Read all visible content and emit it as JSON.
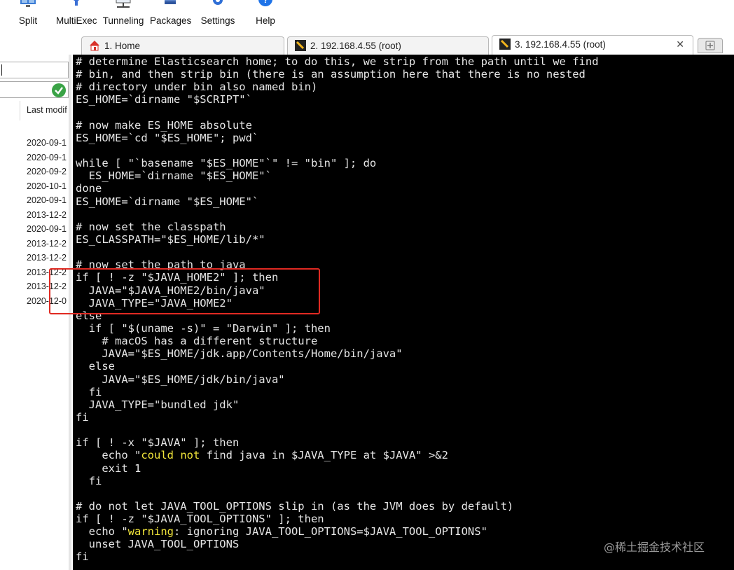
{
  "toolbar": {
    "buttons": [
      {
        "label": "Split",
        "icon": "split-icon"
      },
      {
        "label": "MultiExec",
        "icon": "multiexec-icon"
      },
      {
        "label": "Tunneling",
        "icon": "tunneling-icon"
      },
      {
        "label": "Packages",
        "icon": "packages-icon"
      },
      {
        "label": "Settings",
        "icon": "gear-icon"
      },
      {
        "label": "Help",
        "icon": "help-icon"
      }
    ]
  },
  "tabs": [
    {
      "label": "1. Home",
      "icon": "home-icon",
      "active": false
    },
    {
      "label": "2. 192.168.4.55 (root)",
      "icon": "ssh-icon",
      "active": false
    },
    {
      "label": "3. 192.168.4.55 (root)",
      "icon": "ssh-icon",
      "active": true,
      "close": "✕"
    }
  ],
  "file_browser": {
    "column_header": "Last modif",
    "dates": [
      "2020-09-1",
      "2020-09-1",
      "2020-09-2",
      "2020-10-1",
      "2020-09-1",
      "2013-12-2",
      "2020-09-1",
      "2013-12-2",
      "2013-12-2",
      "2013-12-2",
      "2013-12-2",
      "2020-12-0"
    ]
  },
  "terminal": {
    "lines": [
      "# determine Elasticsearch home; to do this, we strip from the path until we find",
      "# bin, and then strip bin (there is an assumption here that there is no nested",
      "# directory under bin also named bin)",
      "ES_HOME=`dirname \"$SCRIPT\"`",
      "",
      "# now make ES_HOME absolute",
      "ES_HOME=`cd \"$ES_HOME\"; pwd`",
      "",
      "while [ \"`basename \"$ES_HOME\"`\" != \"bin\" ]; do",
      "  ES_HOME=`dirname \"$ES_HOME\"`",
      "done",
      "ES_HOME=`dirname \"$ES_HOME\"`",
      "",
      "# now set the classpath",
      "ES_CLASSPATH=\"$ES_HOME/lib/*\"",
      "",
      "# now set the path to java",
      "if [ ! -z \"$JAVA_HOME2\" ]; then",
      "  JAVA=\"$JAVA_HOME2/bin/java\"",
      "  JAVA_TYPE=\"JAVA_HOME2\"",
      "else",
      "  if [ \"$(uname -s)\" = \"Darwin\" ]; then",
      "    # macOS has a different structure",
      "    JAVA=\"$ES_HOME/jdk.app/Contents/Home/bin/java\"",
      "  else",
      "    JAVA=\"$ES_HOME/jdk/bin/java\"",
      "  fi",
      "  JAVA_TYPE=\"bundled jdk\"",
      "fi",
      "",
      "if [ ! -x \"$JAVA\" ]; then",
      "ECHO1",
      "    exit 1",
      "  fi",
      "",
      "# do not let JAVA_TOOL_OPTIONS slip in (as the JVM does by default)",
      "if [ ! -z \"$JAVA_TOOL_OPTIONS\" ]; then",
      "ECHO2",
      "  unset JAVA_TOOL_OPTIONS",
      "fi"
    ],
    "echo1": {
      "pre": "    echo \"",
      "hl": "could not",
      "post": " find java in $JAVA_TYPE at $JAVA\" >&2"
    },
    "echo2": {
      "pre": "  echo \"",
      "hl": "warning",
      "post": ": ignoring JAVA_TOOL_OPTIONS=$JAVA_TOOL_OPTIONS\""
    }
  },
  "watermark": "@稀土掘金技术社区",
  "colors": {
    "terminal_bg": "#000000",
    "terminal_fg": "#e6e6e6",
    "highlight_text": "#f0e43a",
    "annotation_box": "#e02a22"
  }
}
